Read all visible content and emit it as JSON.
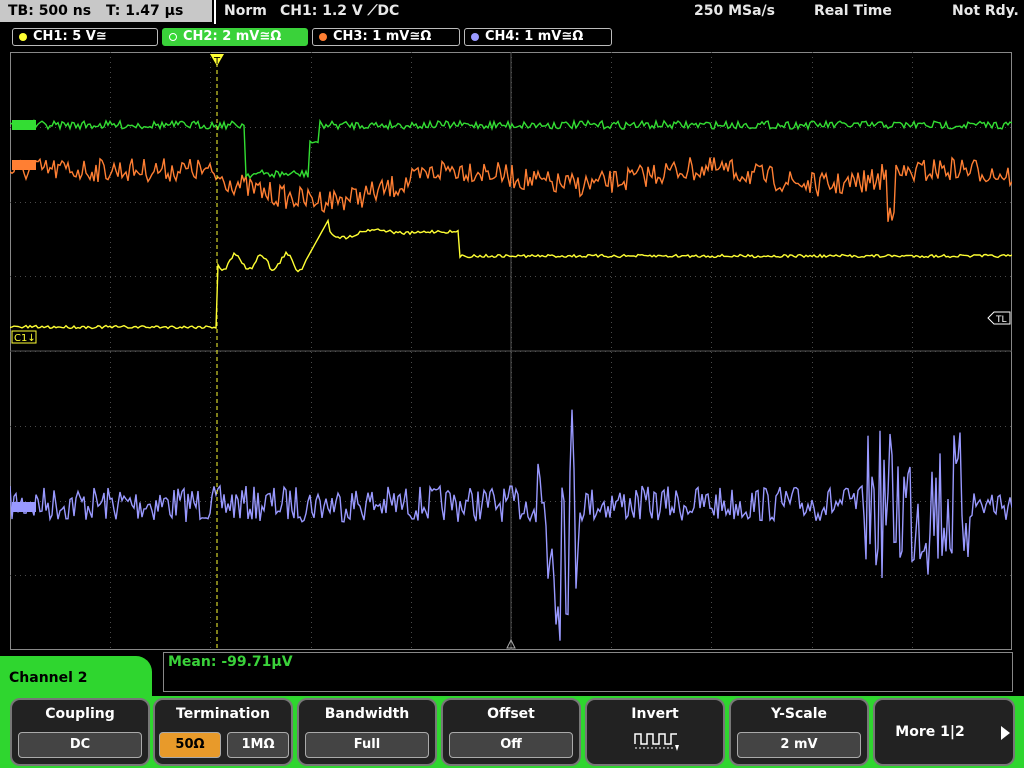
{
  "status": {
    "timebase": "TB: 500 ns",
    "trigger_time": "T: 1.47 µs",
    "mode": "Norm",
    "trigger": "CH1: 1.2 V ⟋DC",
    "sample_rate": "250 MSa/s",
    "acq_mode": "Real Time",
    "state": "Not Rdy."
  },
  "channels": [
    {
      "label": "CH1: 5 V≅",
      "color": "#ffff33"
    },
    {
      "label": "CH2: 2 mV≅Ω",
      "color": "#33dd33"
    },
    {
      "label": "CH3: 1 mV≅Ω",
      "color": "#ff7f33"
    },
    {
      "label": "CH4: 1 mV≅Ω",
      "color": "#9999ff"
    }
  ],
  "markers": {
    "ch1": "C1↓",
    "tl": "TL",
    "trigger": "T"
  },
  "measurement": {
    "mean": "Mean: -99.71µV"
  },
  "menu": {
    "title": "Channel 2",
    "coupling": {
      "title": "Coupling",
      "value": "DC"
    },
    "termination": {
      "title": "Termination",
      "opt1": "50Ω",
      "opt2": "1MΩ"
    },
    "bandwidth": {
      "title": "Bandwidth",
      "value": "Full"
    },
    "offset": {
      "title": "Offset",
      "value": "Off"
    },
    "invert": {
      "title": "Invert"
    },
    "yscale": {
      "title": "Y-Scale",
      "value": "2 mV"
    },
    "more": {
      "title": "More 1|2"
    }
  }
}
